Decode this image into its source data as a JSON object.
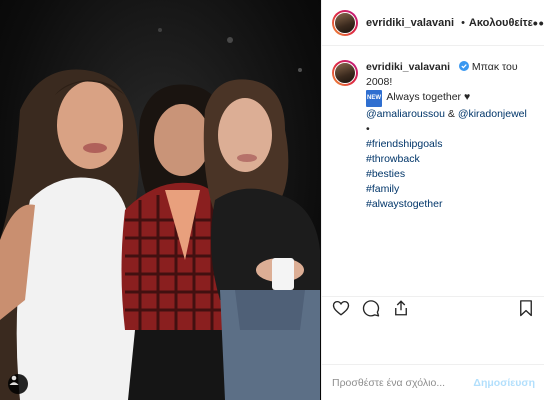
{
  "header": {
    "username": "evridiki_valavani",
    "separator": "•",
    "follow_label": "Ακολουθείτε",
    "more_label": "•••"
  },
  "caption": {
    "username": "evridiki_valavani",
    "line1": "Μπακ του 2008!",
    "badge": "NEW",
    "line2": "Always together ♥",
    "mention1": "@amaliaroussou",
    "amp": "&",
    "mention2": "@kiradonjewel",
    "bullet": "•",
    "hashtags": [
      "#friendshipgoals",
      "#throwback",
      "#besties",
      "#family",
      "#alwaystogether"
    ]
  },
  "comment": {
    "placeholder": "Προσθέστε ένα σχόλιο...",
    "post_label": "Δημοσίευση"
  },
  "icons": {
    "like": "heart-icon",
    "comment": "comment-icon",
    "share": "share-icon",
    "save": "bookmark-icon",
    "verified": "verified-badge-icon",
    "user_tag": "user-tag-icon"
  },
  "colors": {
    "link": "#003569",
    "verified": "#3897f0",
    "post_button_disabled": "#b2dffc",
    "border": "#efefef"
  }
}
